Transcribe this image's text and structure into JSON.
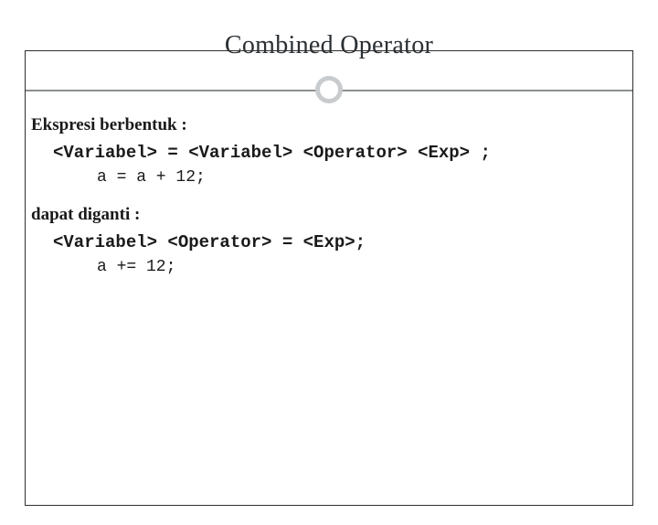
{
  "slide": {
    "title": "Combined Operator",
    "intro1": "Ekspresi berbentuk :",
    "syntax1": "<Variabel> = <Variabel> <Operator> <Exp> ;",
    "example1": "a = a + 12;",
    "intro2": "dapat diganti :",
    "syntax2": "<Variabel> <Operator> = <Exp>;",
    "example2": "a += 12;"
  }
}
